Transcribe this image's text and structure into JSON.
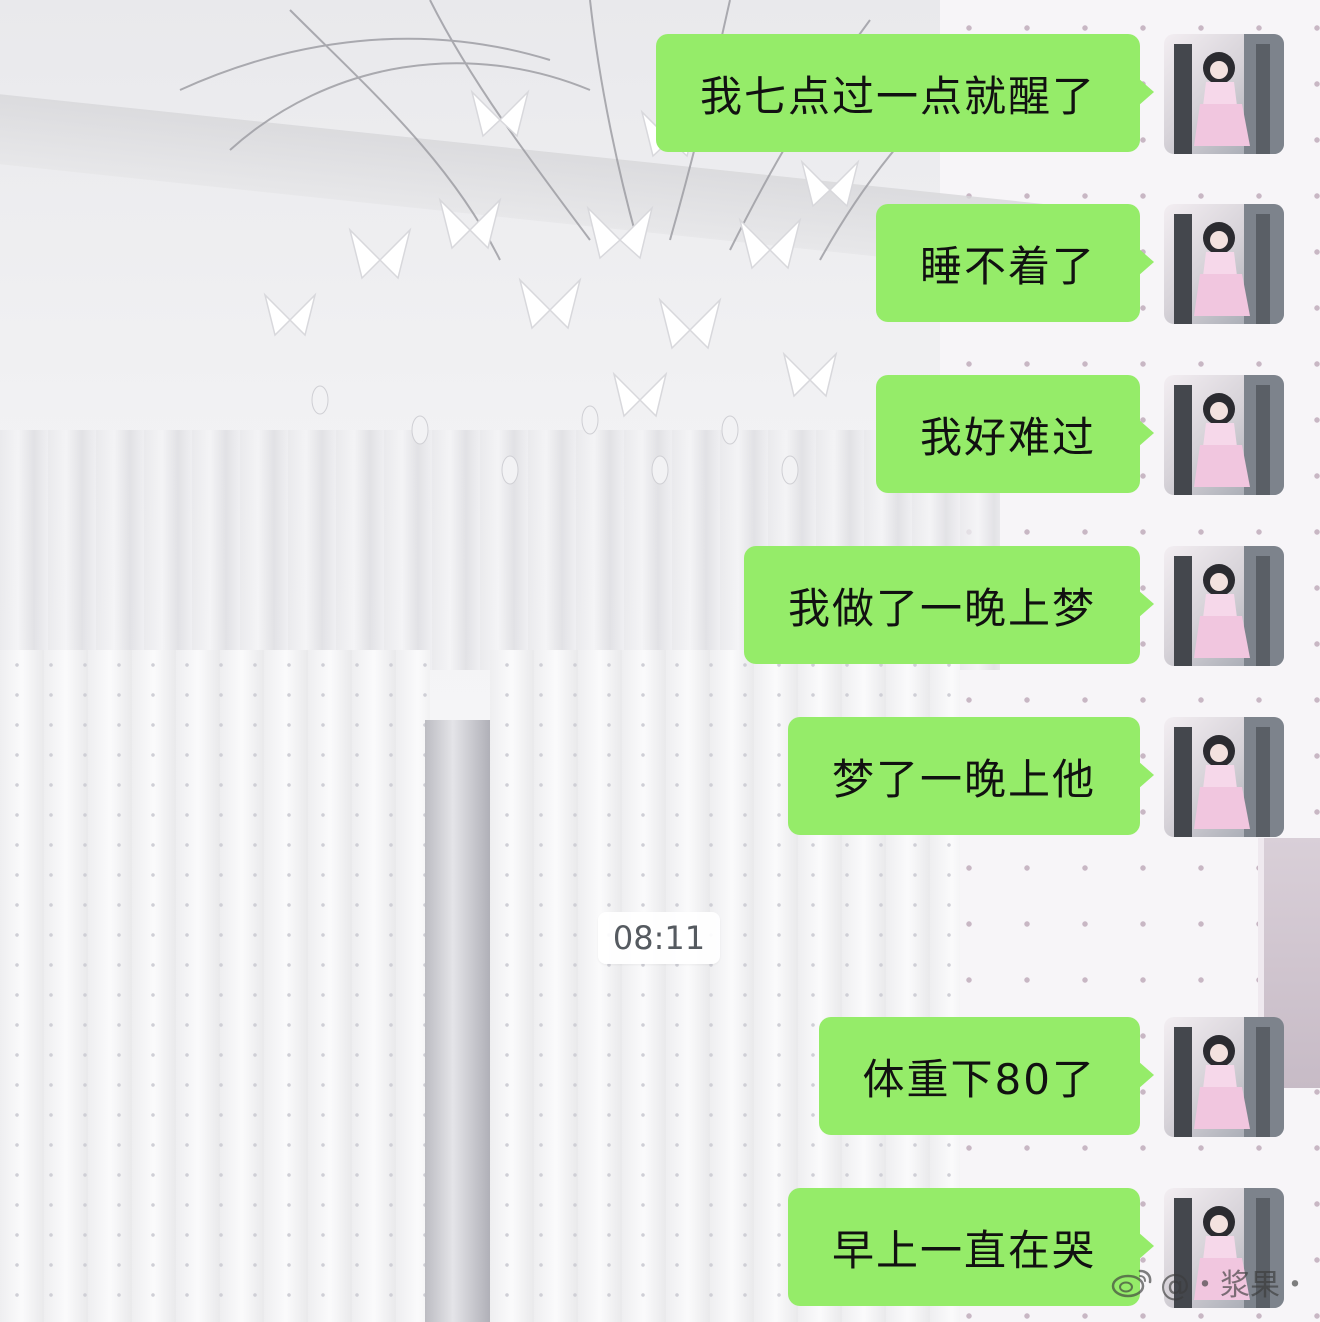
{
  "conversation": {
    "messages": [
      {
        "text": "我七点过一点就醒了",
        "sender": "self"
      },
      {
        "text": "睡不着了",
        "sender": "self"
      },
      {
        "text": "我好难过",
        "sender": "self"
      },
      {
        "text": "我做了一晚上梦",
        "sender": "self"
      },
      {
        "text": "梦了一晚上他",
        "sender": "self"
      },
      {
        "text": "体重下80了",
        "sender": "self"
      },
      {
        "text": "早上一直在哭",
        "sender": "self"
      }
    ],
    "timestamp": "08:11"
  },
  "watermark": {
    "text": "@・浆果・",
    "icon": "weibo-icon"
  },
  "colors": {
    "bubble": "#95ec69",
    "text": "#111111",
    "timestamp_bg": "#ffffff"
  }
}
